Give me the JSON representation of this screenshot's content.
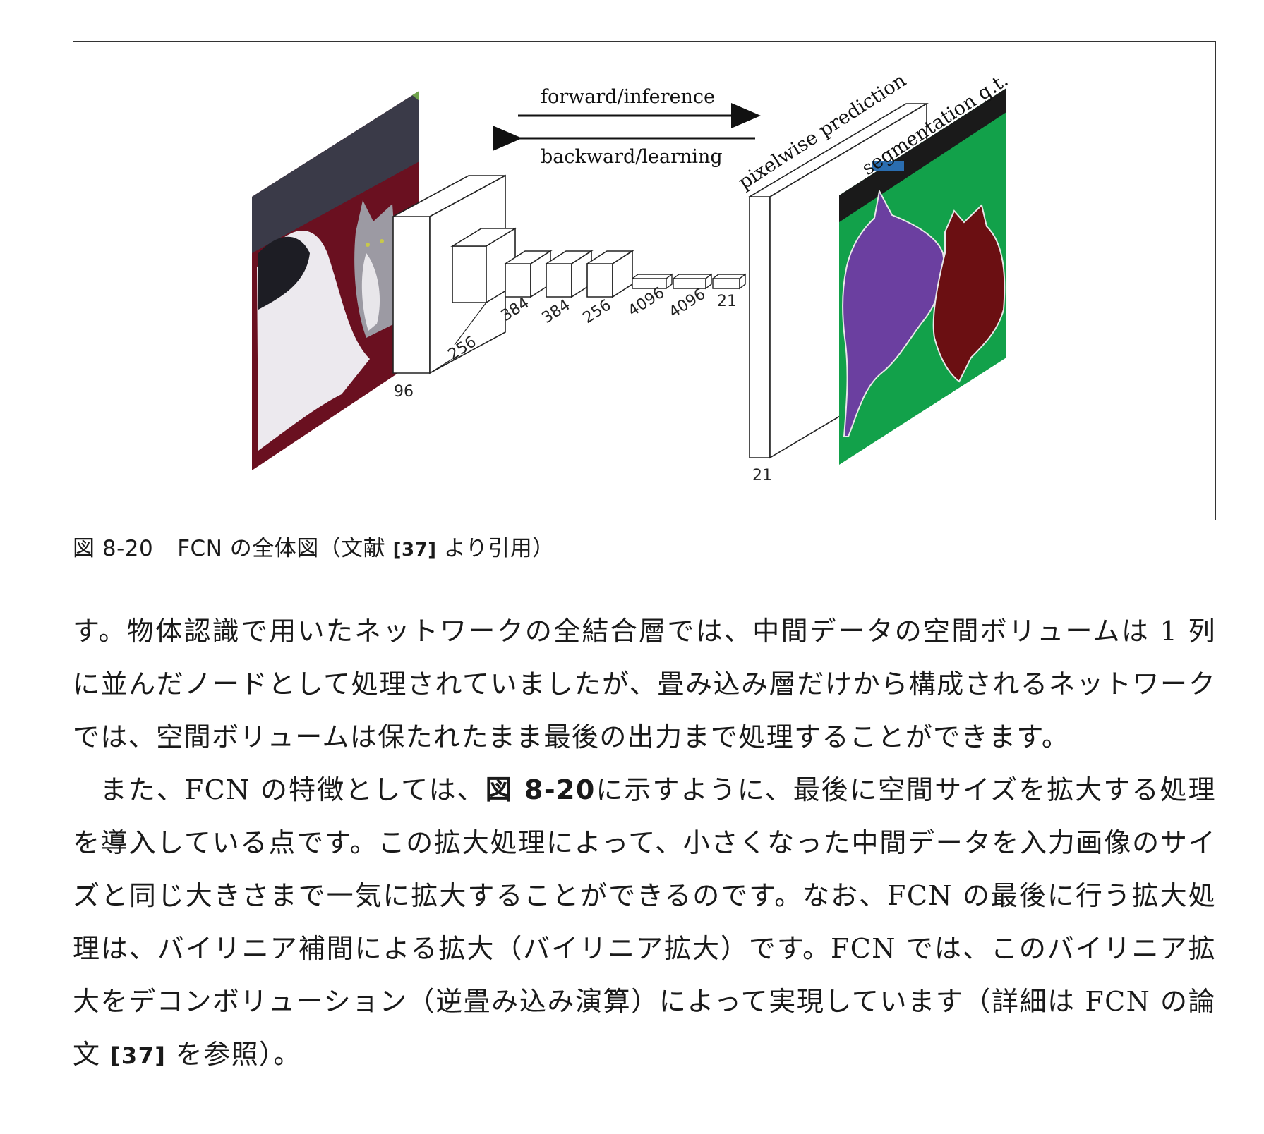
{
  "figure": {
    "forward_label": "forward/inference",
    "backward_label": "backward/learning",
    "pixelwise_label": "pixelwise prediction",
    "segmentation_label": "segmentation g.t.",
    "layer_labels": [
      "96",
      "256",
      "384",
      "384",
      "256",
      "4096",
      "4096",
      "21",
      "21"
    ],
    "colors": {
      "segmentation_background": "#12a14a",
      "dog_class": "#6b3fa0",
      "cat_class": "#6b0f12",
      "boundary": "#e8e8e8",
      "void_band": "#1a1a1a",
      "marker": "#2a6db0",
      "photo_background": "#6a1020"
    }
  },
  "caption": {
    "number": "図 8-20",
    "title": "FCN の全体図（文献",
    "ref": "[37]",
    "suffix": "より引用）"
  },
  "paragraphs": {
    "p1": "す。物体認識で用いたネットワークの全結合層では、中間データの空間ボリュームは 1 列に並んだノードとして処理されていましたが、畳み込み層だけから構成されるネットワークでは、空間ボリュームは保たれたまま最後の出力まで処理することができます。",
    "p2_a": "また、FCN の特徴としては、",
    "p2_ref": "図 8-20",
    "p2_b": "に示すように、最後に空間サイズを拡大する処理を導入している点です。この拡大処理によって、小さくなった中間データを入力画像のサイズと同じ大きさまで一気に拡大することができるのです。なお、FCN の最後に行う拡大処理は、バイリニア補間による拡大（バイリニア拡大）です。FCN では、このバイリニア拡大をデコンボリューション（逆畳み込み演算）によって実現しています（詳細は FCN の論文",
    "p2_cite": "[37]",
    "p2_c": "を参照）。"
  }
}
